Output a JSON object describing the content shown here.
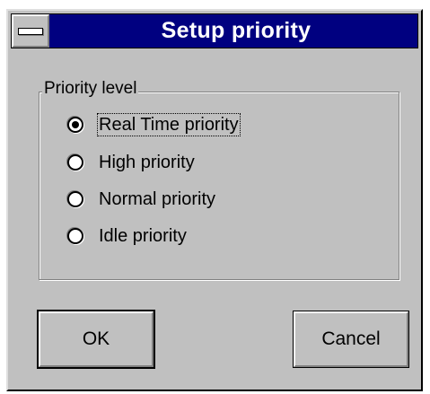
{
  "window": {
    "title": "Setup priority"
  },
  "group": {
    "label": "Priority level",
    "options": [
      {
        "label": "Real Time priority",
        "checked": true
      },
      {
        "label": "High priority",
        "checked": false
      },
      {
        "label": "Normal priority",
        "checked": false
      },
      {
        "label": "Idle priority",
        "checked": false
      }
    ]
  },
  "buttons": {
    "ok_label": "OK",
    "cancel_label": "Cancel"
  },
  "colors": {
    "titlebar": "#000080",
    "face": "#c0c0c0"
  },
  "icons": {
    "system_menu": "system-menu-icon"
  }
}
